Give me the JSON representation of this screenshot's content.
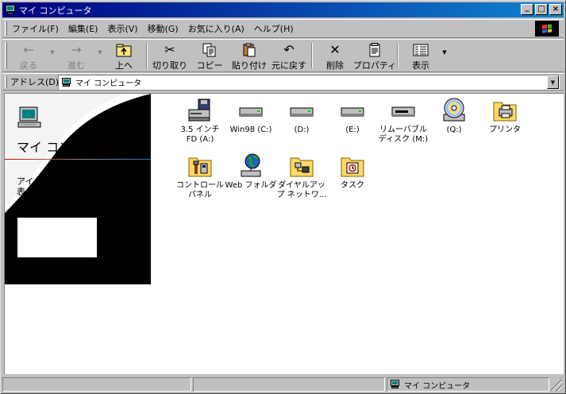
{
  "window": {
    "title": "マイ コンピュータ",
    "controls": {
      "minimize": "_",
      "maximize": "□",
      "close": "×"
    }
  },
  "menu": [
    "ファイル(F)",
    "編集(E)",
    "表示(V)",
    "移動(G)",
    "お気に入り(A)",
    "ヘルプ(H)"
  ],
  "toolbar": {
    "back": "戻る",
    "forward": "進む",
    "up": "上へ",
    "cut": "切り取り",
    "copy": "コピー",
    "paste": "貼り付け",
    "undo": "元に戻す",
    "delete": "削除",
    "properties": "プロパティ",
    "view": "表示"
  },
  "address": {
    "label": "アドレス(D)",
    "value": "マイ コンピュータ"
  },
  "webview": {
    "title": "マイ コンピ",
    "desc_line1": "アイ",
    "desc_line2": "表"
  },
  "items": [
    {
      "line1": "3.5 インチ",
      "line2": "FD (A:)",
      "icon": "floppy-drive-icon"
    },
    {
      "line1": "Win98 (C:)",
      "line2": "",
      "icon": "hard-drive-icon"
    },
    {
      "line1": "(D:)",
      "line2": "",
      "icon": "hard-drive-icon"
    },
    {
      "line1": "(E:)",
      "line2": "",
      "icon": "hard-drive-icon"
    },
    {
      "line1": "リムーバブル",
      "line2": "ディスク (M:)",
      "icon": "removable-disk-icon"
    },
    {
      "line1": "(Q:)",
      "line2": "",
      "icon": "cd-drive-icon"
    },
    {
      "line1": "プリンタ",
      "line2": "",
      "icon": "printers-folder-icon"
    },
    {
      "line1": "コントロール",
      "line2": "パネル",
      "icon": "control-panel-icon"
    },
    {
      "line1": "Web フォルダ",
      "line2": "",
      "icon": "web-folder-icon"
    },
    {
      "line1": "ダイヤルアッ",
      "line2": "プ ネットワ...",
      "icon": "dial-up-networking-icon"
    },
    {
      "line1": "タスク",
      "line2": "",
      "icon": "scheduled-tasks-icon"
    }
  ],
  "status": {
    "pane1": "",
    "pane2": "",
    "location": "マイ コンピュータ"
  }
}
